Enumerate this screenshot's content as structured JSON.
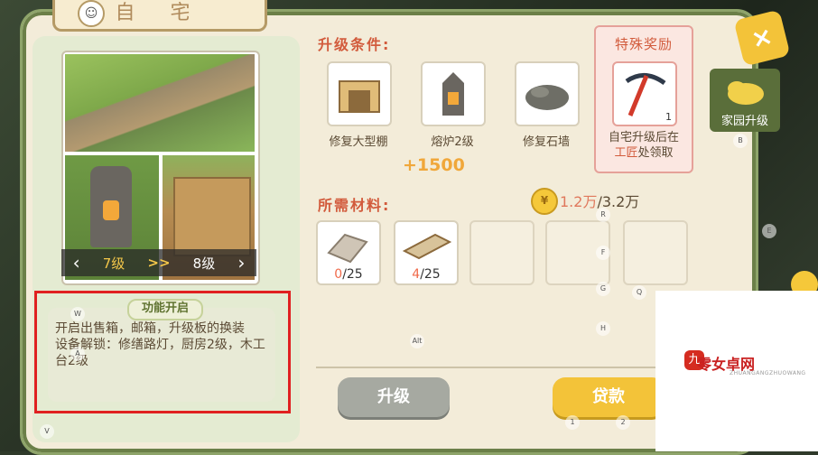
{
  "window": {
    "title": "自 宅"
  },
  "preview": {
    "current_level": "7级",
    "arrows": ">>",
    "next_level": "8级"
  },
  "feature": {
    "title": "功能开启",
    "lines": [
      "开启出售箱，邮箱，升级板的换装",
      "设备解锁：修缮路灯，厨房2级，木工台2级"
    ]
  },
  "requirements": {
    "label": "升级条件:",
    "items": [
      {
        "label": "修复大型棚",
        "icon": "shed-icon"
      },
      {
        "label": "熔炉2级",
        "icon": "furnace-icon"
      },
      {
        "label": "修复石墙",
        "icon": "stone-wall-icon"
      }
    ],
    "score": "+1500"
  },
  "special_reward": {
    "title": "特殊奖励",
    "count": "1",
    "icon": "pickaxe-icon",
    "text_pre": "自宅升级后在",
    "text_hl": "工匠",
    "text_post": "处领取"
  },
  "materials": {
    "label": "所需材料:",
    "currency": {
      "have": "1.2万",
      "need": "/3.2万",
      "icon": "coin-icon"
    },
    "items": [
      {
        "have": "0",
        "need": "/25",
        "icon": "cloth-icon"
      },
      {
        "have": "4",
        "need": "/25",
        "icon": "plank-icon"
      }
    ]
  },
  "buttons": {
    "upgrade": "升级",
    "loan": "贷款"
  },
  "side": {
    "label": "家园升级",
    "close": "×"
  },
  "key_hints": {
    "w": "W",
    "a": "A",
    "v": "V",
    "alt": "Alt",
    "r": "R",
    "f": "F",
    "g": "G",
    "h": "H",
    "q": "Q",
    "b": "B",
    "e": "E",
    "one": "1",
    "two": "2"
  },
  "watermark": {
    "text": "零女卓网",
    "sub": "ZHUANGANGZHUOWANG"
  },
  "colors": {
    "accent_red": "#d25b3c",
    "button_yellow": "#f3c339",
    "button_gray": "#a6a9a1",
    "highlight_border": "#e02020"
  }
}
